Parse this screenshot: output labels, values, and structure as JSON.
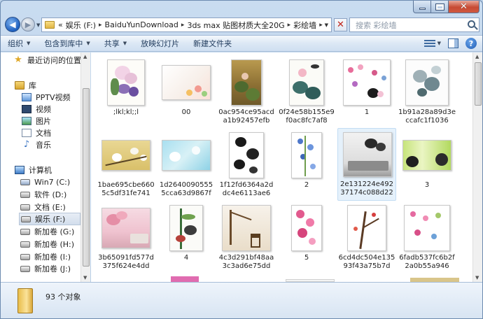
{
  "window": {
    "colors": {
      "chrome": "#bcd3ea",
      "close": "#c74a33",
      "selection": "#e5f1fb"
    }
  },
  "address": {
    "prefix": "«",
    "crumbs": [
      "娱乐 (F:)",
      "BaiduYunDownload",
      "3ds max 贴图材质大全20G",
      "彩绘墙"
    ],
    "search_placeholder": "搜索 彩绘墙"
  },
  "toolbar": {
    "items": [
      {
        "label": "组织",
        "dropdown": true
      },
      {
        "label": "包含到库中",
        "dropdown": true
      },
      {
        "label": "共享",
        "dropdown": true
      },
      {
        "label": "放映幻灯片",
        "dropdown": false
      },
      {
        "label": "新建文件夹",
        "dropdown": false
      }
    ]
  },
  "nav": {
    "items": [
      {
        "label": "最近访问的位置",
        "icon": "star-icon"
      },
      {
        "label": "库",
        "icon": "library-icon"
      },
      {
        "label": "PPTV视频",
        "icon": "pptv-icon"
      },
      {
        "label": "视频",
        "icon": "video-icon"
      },
      {
        "label": "图片",
        "icon": "pictures-icon"
      },
      {
        "label": "文档",
        "icon": "documents-icon"
      },
      {
        "label": "音乐",
        "icon": "music-icon"
      },
      {
        "label": "计算机",
        "icon": "computer-icon"
      },
      {
        "label": "Win7 (C:)",
        "icon": "drive-icon"
      },
      {
        "label": "软件 (D:)",
        "icon": "drive-icon"
      },
      {
        "label": "文档 (E:)",
        "icon": "drive-icon"
      },
      {
        "label": "娱乐 (F:)",
        "icon": "drive-icon",
        "selected": true
      },
      {
        "label": "新加卷 (G:)",
        "icon": "drive-icon"
      },
      {
        "label": "新加卷 (H:)",
        "icon": "drive-icon"
      },
      {
        "label": "新加卷 (I:)",
        "icon": "drive-icon"
      },
      {
        "label": "新加卷 (J:)",
        "icon": "drive-icon"
      }
    ]
  },
  "files": [
    {
      "name": ";lkl;kl;;l"
    },
    {
      "name": "00"
    },
    {
      "name": "0ac954ce95acda1b92457efb"
    },
    {
      "name": "0f24e58b155e9f0ac8fc7af8"
    },
    {
      "name": "1"
    },
    {
      "name": "1b91a28a89d3eccafc1f1036"
    },
    {
      "name": "1bae695cbe6605c5df31fe741"
    },
    {
      "name": "1d26400905555cca63d9867f"
    },
    {
      "name": "1f12fd6364a2ddc4e6113ae6"
    },
    {
      "name": "2"
    },
    {
      "name": "2e131224e49237174c088d22",
      "selected": true
    },
    {
      "name": "3"
    },
    {
      "name": "3b65091fd577d375f624e4dd"
    },
    {
      "name": "4"
    },
    {
      "name": "4c3d291bf48aa3c3ad6e75dd"
    },
    {
      "name": "5"
    },
    {
      "name": "6cd4dc504e13593f43a75b7d"
    },
    {
      "name": "6fadb537fc6b2f2a0b55a946"
    }
  ],
  "status": {
    "count_text": "93 个对象"
  }
}
